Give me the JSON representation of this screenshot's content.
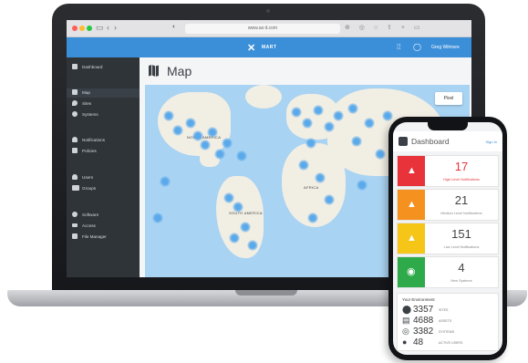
{
  "browser": {
    "url": "www.ax-it.com",
    "nav_icons": [
      "sidebar-icon",
      "back-icon",
      "forward-icon"
    ]
  },
  "app": {
    "logo_text": "MART",
    "user_name": "Greg Wilmore",
    "brand_color": "#3b8fd9"
  },
  "sidebar": {
    "items": [
      {
        "label": "Dashboard",
        "icon": "dashboard-icon"
      },
      {
        "label": "Map",
        "icon": "map-icon"
      },
      {
        "label": "Sites",
        "icon": "pin-icon"
      },
      {
        "label": "Systems",
        "icon": "gear-icon"
      },
      {
        "label": "Notifications",
        "icon": "bell-icon"
      },
      {
        "label": "Policies",
        "icon": "policy-icon"
      },
      {
        "label": "Users",
        "icon": "user-icon"
      },
      {
        "label": "Groups",
        "icon": "group-icon"
      },
      {
        "label": "Software",
        "icon": "cloud-icon"
      },
      {
        "label": "Access",
        "icon": "key-icon"
      },
      {
        "label": "File Manager",
        "icon": "folder-icon"
      }
    ],
    "active": "Map"
  },
  "main": {
    "page_title": "Map",
    "map_button": "Pixel",
    "labels": {
      "north_america": "NORTH AMERICA",
      "south_america": "SOUTH AMERICA",
      "africa": "AFRICA"
    }
  },
  "phone": {
    "title": "Dashboard",
    "link": "Sign In",
    "cards": [
      {
        "value": "17",
        "caption": "High Level Notifications",
        "color": "#e8333a",
        "icon": "bell-icon"
      },
      {
        "value": "21",
        "caption": "Medium Level Notifications",
        "color": "#f5911e",
        "icon": "bell-icon"
      },
      {
        "value": "151",
        "caption": "Low Level Notifications",
        "color": "#f5c518",
        "icon": "bell-icon"
      },
      {
        "value": "4",
        "caption": "New Systems",
        "color": "#2eaa4a",
        "icon": "clock-icon"
      }
    ],
    "environment": {
      "title": "Your Environment",
      "rows": [
        {
          "value": "3357",
          "caption": "SITES",
          "icon": "pin-icon"
        },
        {
          "value": "4688",
          "caption": "ASSETS",
          "icon": "server-icon"
        },
        {
          "value": "3382",
          "caption": "SYSTEMS",
          "icon": "system-icon"
        },
        {
          "value": "48",
          "caption": "ACTIVE USERS",
          "icon": "user-icon"
        }
      ]
    }
  }
}
